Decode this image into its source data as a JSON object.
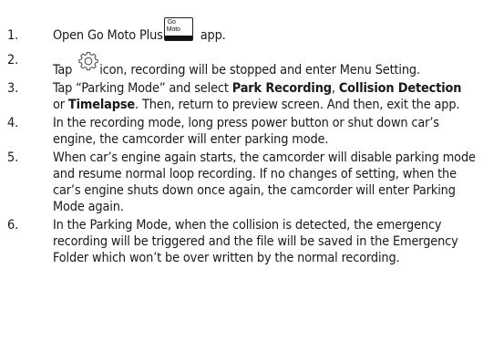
{
  "steps": [
    {
      "number": "1.",
      "text_before": "Open Go Moto Plus",
      "icon_label_top": "Go",
      "icon_label_bottom": "Moto",
      "text_after": " app."
    },
    {
      "number": "2.",
      "text_before": "Tap ",
      "text_after": "icon, recording will be stopped and enter Menu Setting."
    },
    {
      "number": "3.",
      "text_1": "Tap “Parking Mode” and select ",
      "bold_1": "Park Recording",
      "text_2": ", ",
      "bold_2": "Collision Detection",
      "text_3": " or ",
      "bold_3": "Timelapse",
      "text_4": ". Then, return to preview screen. And then, exit the app."
    },
    {
      "number": "4.",
      "text": "In the recording mode, long press power button or shut down car’s engine, the camcorder will enter parking mode."
    },
    {
      "number": "5.",
      "text": "When car’s engine again starts, the camcorder will disable parking mode and resume normal loop recording. If no changes of setting, when the car’s engine shuts down once again, the camcorder will enter Parking Mode again."
    },
    {
      "number": "6.",
      "text": "In the Parking Mode, when the collision is detected, the emergency recording will be triggered and the file will be saved in the Emergency Folder which won’t be over written by the normal recording."
    }
  ]
}
